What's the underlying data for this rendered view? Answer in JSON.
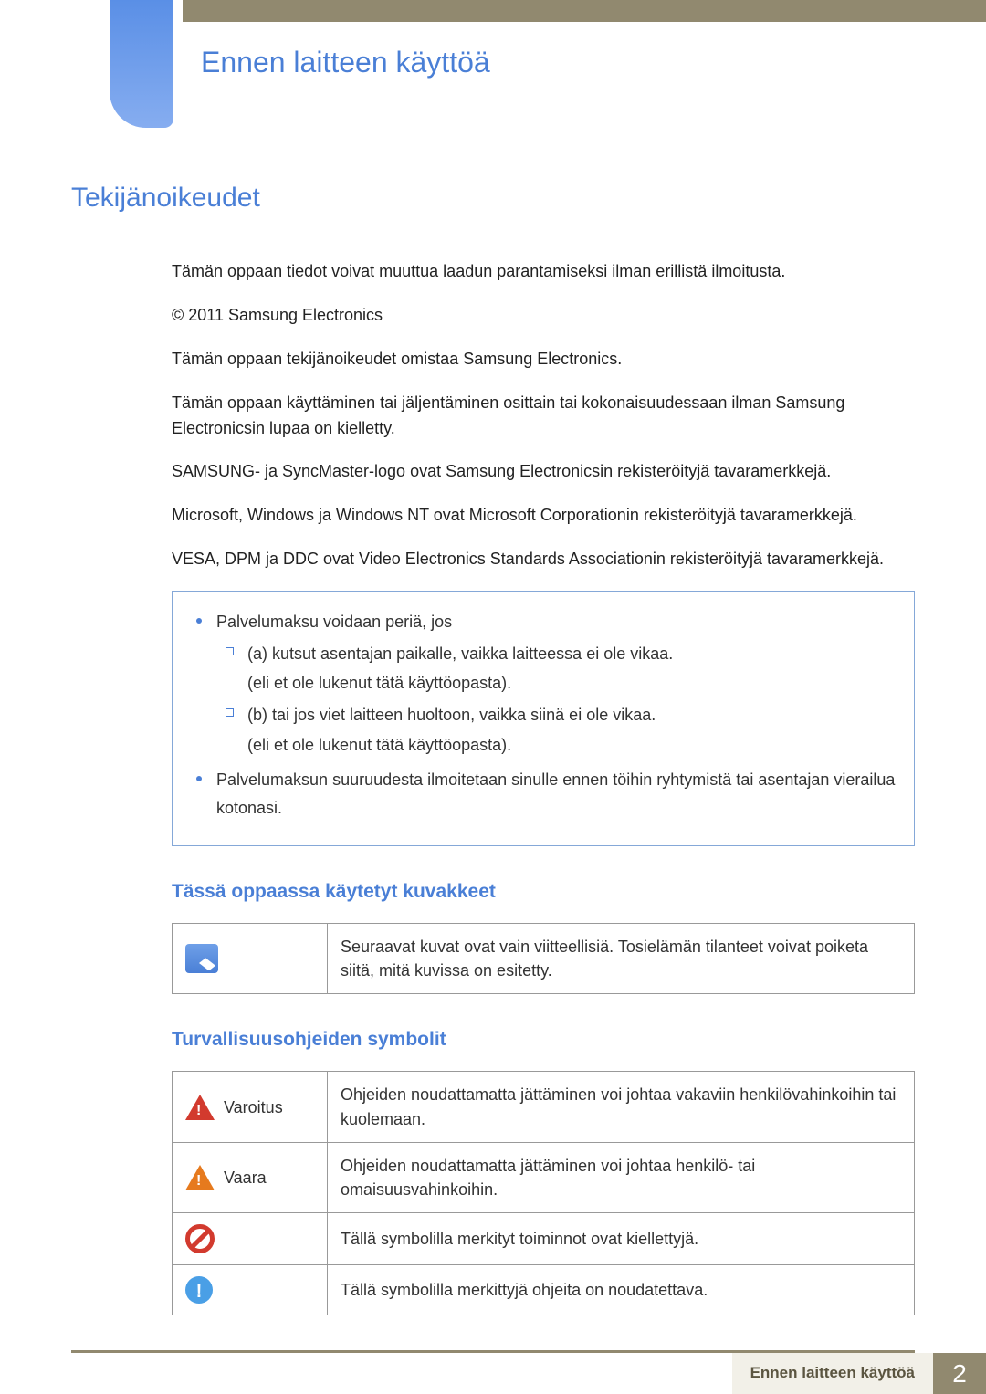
{
  "header": {
    "title": "Ennen laitteen käyttöä"
  },
  "section": {
    "h1": "Tekijänoikeudet",
    "paragraphs": [
      "Tämän oppaan tiedot voivat muuttua laadun parantamiseksi ilman erillistä ilmoitusta.",
      "© 2011 Samsung Electronics",
      "Tämän oppaan tekijänoikeudet omistaa Samsung Electronics.",
      "Tämän oppaan käyttäminen tai jäljentäminen osittain tai kokonaisuudessaan ilman Samsung Electronicsin lupaa on kielletty.",
      "SAMSUNG- ja SyncMaster-logo ovat Samsung Electronicsin rekisteröityjä tavaramerkkejä.",
      "Microsoft, Windows ja Windows NT ovat Microsoft Corporationin rekisteröityjä tavaramerkkejä.",
      "VESA, DPM ja DDC ovat Video Electronics Standards Associationin rekisteröityjä tavaramerkkejä."
    ]
  },
  "infoBox": {
    "item1": "Palvelumaksu voidaan periä, jos",
    "sub_a": "(a) kutsut asentajan paikalle, vaikka laitteessa ei ole vikaa.",
    "sub_a_note": "(eli et ole lukenut tätä käyttöopasta).",
    "sub_b": "(b) tai jos viet laitteen huoltoon, vaikka siinä ei ole vikaa.",
    "sub_b_note": "(eli et ole lukenut tätä käyttöopasta).",
    "item2": "Palvelumaksun suuruudesta ilmoitetaan sinulle ennen töihin ryhtymistä tai asentajan vierailua kotonasi."
  },
  "iconsHeading": "Tässä oppaassa käytetyt kuvakkeet",
  "noteRow": {
    "text": "Seuraavat kuvat ovat vain viitteellisiä. Tosielämän tilanteet voivat poiketa siitä, mitä kuvissa on esitetty."
  },
  "safetyHeading": "Turvallisuusohjeiden symbolit",
  "safetyTable": [
    {
      "label": "Varoitus",
      "desc": "Ohjeiden noudattamatta jättäminen voi johtaa vakaviin henkilövahinkoihin tai kuolemaan."
    },
    {
      "label": "Vaara",
      "desc": "Ohjeiden noudattamatta jättäminen voi johtaa henkilö- tai omaisuusvahinkoihin."
    },
    {
      "label": "",
      "desc": "Tällä symbolilla merkityt toiminnot ovat kiellettyjä."
    },
    {
      "label": "",
      "desc": "Tällä symbolilla merkittyjä ohjeita on noudatettava."
    }
  ],
  "footer": {
    "label": "Ennen laitteen käyttöä",
    "page": "2"
  }
}
